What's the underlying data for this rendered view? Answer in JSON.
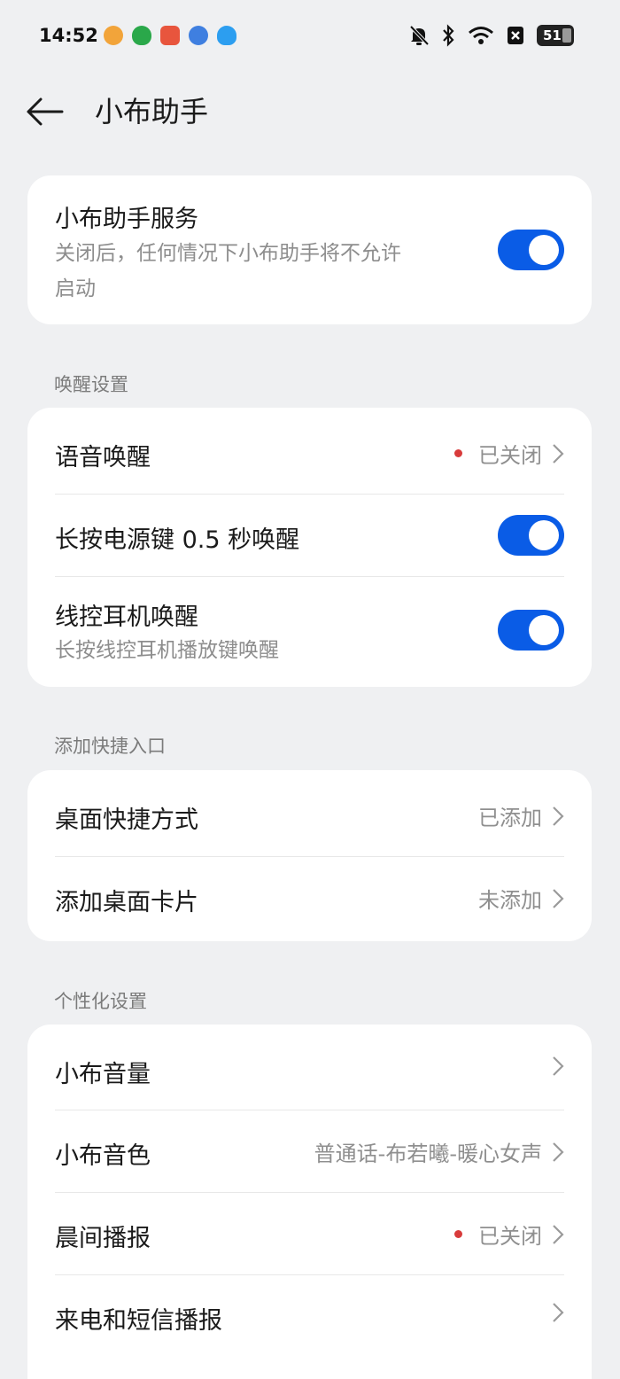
{
  "status_bar": {
    "time": "14:52",
    "battery": "51",
    "notification_icons": [
      "weibo-icon",
      "shield-app-icon",
      "game-app-icon",
      "blue-app-icon",
      "qq-icon"
    ],
    "system_icons": [
      "mute-bell-icon",
      "bluetooth-icon",
      "wifi-icon",
      "x-box-icon",
      "battery-icon"
    ]
  },
  "header": {
    "title": "小布助手"
  },
  "service": {
    "title": "小布助手服务",
    "subtitle_line1": "关闭后，任何情况下小布助手将不允许",
    "subtitle_line2": "启动",
    "enabled": true
  },
  "wake_section": {
    "label": "唤醒设置",
    "voice_wake": {
      "title": "语音唤醒",
      "status": "已关闭"
    },
    "power_key": {
      "title": "长按电源键 0.5 秒唤醒",
      "enabled": true
    },
    "headset": {
      "title": "线控耳机唤醒",
      "subtitle": "长按线控耳机播放键唤醒",
      "enabled": true
    }
  },
  "shortcut_section": {
    "label": "添加快捷入口",
    "desktop_shortcut": {
      "title": "桌面快捷方式",
      "status": "已添加"
    },
    "desktop_card": {
      "title": "添加桌面卡片",
      "status": "未添加"
    }
  },
  "personal_section": {
    "label": "个性化设置",
    "volume": {
      "title": "小布音量"
    },
    "voice_tone": {
      "title": "小布音色",
      "value": "普通话-布若曦-暖心女声"
    },
    "morning": {
      "title": "晨间播报",
      "status": "已关闭"
    },
    "call_sms": {
      "title": "来电和短信播报"
    }
  },
  "colors": {
    "accent": "#0a5ce6",
    "background": "#eff0f2",
    "card": "#ffffff",
    "red_dot": "#d83b3b"
  }
}
